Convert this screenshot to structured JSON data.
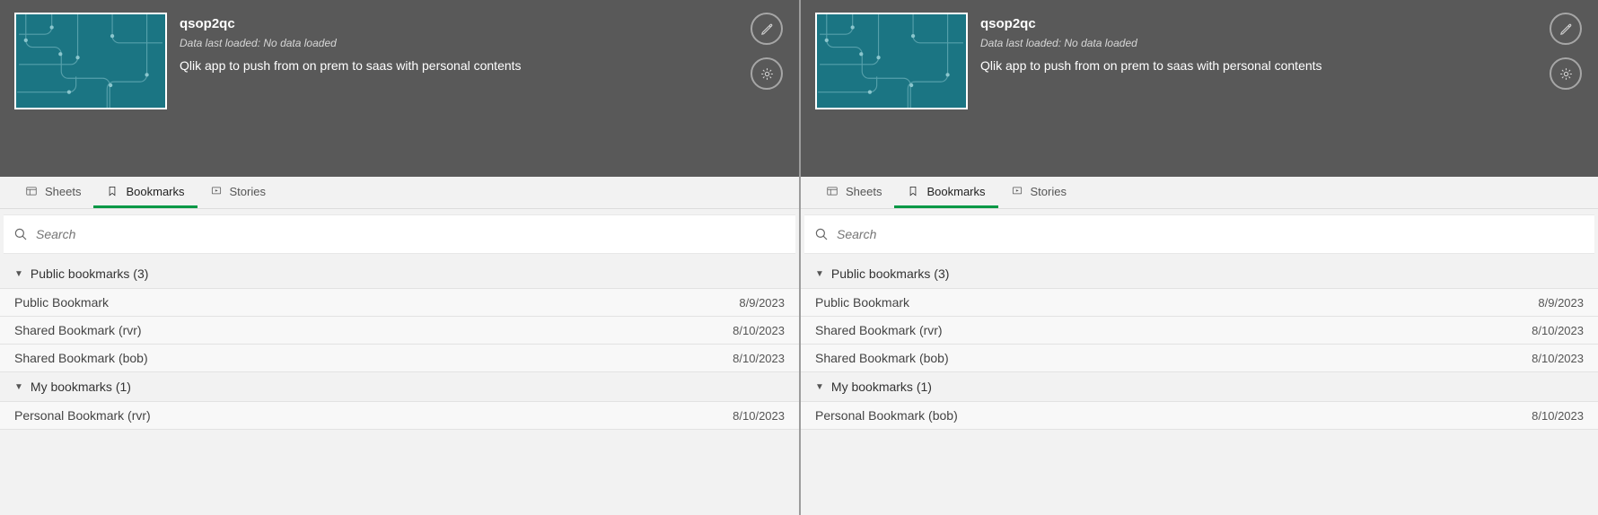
{
  "left": {
    "header": {
      "title": "qsop2qc",
      "subtitle": "Data last loaded: No data loaded",
      "desc": "Qlik app to push from on prem to saas with personal contents"
    },
    "tabs": {
      "sheets": "Sheets",
      "bookmarks": "Bookmarks",
      "stories": "Stories"
    },
    "search": {
      "placeholder": "Search"
    },
    "groups": {
      "public": {
        "label": "Public bookmarks (3)"
      },
      "my": {
        "label": "My bookmarks (1)"
      }
    },
    "public_rows": [
      {
        "name": "Public Bookmark",
        "date": "8/9/2023"
      },
      {
        "name": "Shared Bookmark (rvr)",
        "date": "8/10/2023"
      },
      {
        "name": "Shared Bookmark (bob)",
        "date": "8/10/2023"
      }
    ],
    "my_rows": [
      {
        "name": "Personal Bookmark (rvr)",
        "date": "8/10/2023"
      }
    ]
  },
  "right": {
    "header": {
      "title": "qsop2qc",
      "subtitle": "Data last loaded: No data loaded",
      "desc": "Qlik app to push from on prem to saas with personal contents"
    },
    "tabs": {
      "sheets": "Sheets",
      "bookmarks": "Bookmarks",
      "stories": "Stories"
    },
    "search": {
      "placeholder": "Search"
    },
    "groups": {
      "public": {
        "label": "Public bookmarks (3)"
      },
      "my": {
        "label": "My bookmarks (1)"
      }
    },
    "public_rows": [
      {
        "name": "Public Bookmark",
        "date": "8/9/2023"
      },
      {
        "name": "Shared Bookmark (rvr)",
        "date": "8/10/2023"
      },
      {
        "name": "Shared Bookmark (bob)",
        "date": "8/10/2023"
      }
    ],
    "my_rows": [
      {
        "name": "Personal Bookmark (bob)",
        "date": "8/10/2023"
      }
    ]
  }
}
